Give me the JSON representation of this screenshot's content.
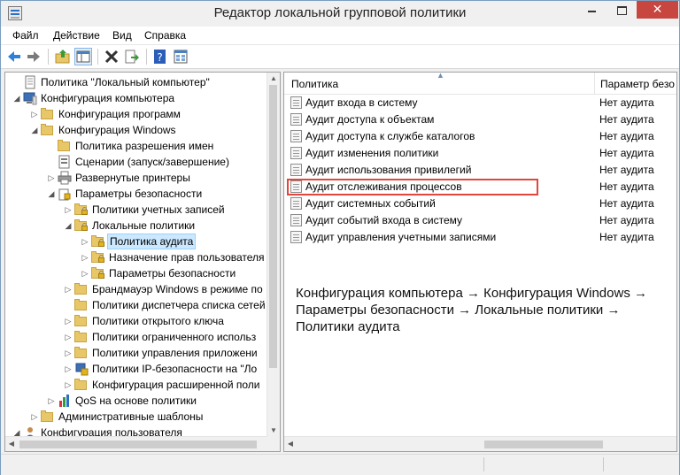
{
  "window": {
    "title": "Редактор локальной групповой политики",
    "controls": {
      "minimize": "minimize-icon",
      "maximize": "maximize-icon",
      "close": "✕"
    }
  },
  "menu": [
    {
      "label": "Файл"
    },
    {
      "label": "Действие"
    },
    {
      "label": "Вид"
    },
    {
      "label": "Справка"
    }
  ],
  "toolbar": {
    "icons": [
      "back-arrow-icon",
      "forward-arrow-icon",
      "up-folder-icon",
      "show-hide-tree-icon",
      "delete-icon",
      "export-list-icon",
      "help-icon",
      "properties-icon"
    ]
  },
  "tree": [
    {
      "label": "Политика \"Локальный компьютер\"",
      "icon": "computer-policy-icon",
      "expander": ""
    },
    {
      "label": "Конфигурация компьютера",
      "icon": "computer-icon",
      "expander": "◢"
    },
    {
      "label": "Конфигурация программ",
      "icon": "folder-icon",
      "expander": "▷"
    },
    {
      "label": "Конфигурация Windows",
      "icon": "folder-icon",
      "expander": "◢"
    },
    {
      "label": "Политика разрешения имен",
      "icon": "folder-icon",
      "expander": ""
    },
    {
      "label": "Сценарии (запуск/завершение)",
      "icon": "script-icon",
      "expander": ""
    },
    {
      "label": "Развернутые принтеры",
      "icon": "printer-icon",
      "expander": "▷"
    },
    {
      "label": "Параметры безопасности",
      "icon": "security-settings-icon",
      "expander": "◢"
    },
    {
      "label": "Политики учетных записей",
      "icon": "locked-folder-icon",
      "expander": "▷"
    },
    {
      "label": "Локальные политики",
      "icon": "locked-folder-icon",
      "expander": "◢"
    },
    {
      "label": "Политика аудита",
      "icon": "locked-folder-icon",
      "expander": "▷",
      "selected": true
    },
    {
      "label": "Назначение прав пользователя",
      "icon": "locked-folder-icon",
      "expander": "▷"
    },
    {
      "label": "Параметры безопасности",
      "icon": "locked-folder-icon",
      "expander": "▷"
    },
    {
      "label": "Брандмауэр Windows в режиме по",
      "icon": "folder-icon",
      "expander": "▷"
    },
    {
      "label": "Политики диспетчера списка сетей",
      "icon": "folder-icon",
      "expander": ""
    },
    {
      "label": "Политики открытого ключа",
      "icon": "folder-icon",
      "expander": "▷"
    },
    {
      "label": "Политики ограниченного использ",
      "icon": "folder-icon",
      "expander": "▷"
    },
    {
      "label": "Политики управления приложени",
      "icon": "folder-icon",
      "expander": "▷"
    },
    {
      "label": "Политики IP-безопасности на \"Ло",
      "icon": "ip-security-icon",
      "expander": "▷"
    },
    {
      "label": "Конфигурация расширенной поли",
      "icon": "folder-icon",
      "expander": "▷"
    },
    {
      "label": "QoS на основе политики",
      "icon": "qos-chart-icon",
      "expander": "▷"
    },
    {
      "label": "Административные шаблоны",
      "icon": "folder-icon",
      "expander": "▷"
    },
    {
      "label": "Конфигурация пользователя",
      "icon": "user-icon",
      "expander": "◢"
    }
  ],
  "list": {
    "columns": {
      "policy": "Политика",
      "setting": "Параметр безо"
    },
    "rows": [
      {
        "name": "Аудит входа в систему",
        "value": "Нет аудита"
      },
      {
        "name": "Аудит доступа к объектам",
        "value": "Нет аудита"
      },
      {
        "name": "Аудит доступа к службе каталогов",
        "value": "Нет аудита"
      },
      {
        "name": "Аудит изменения политики",
        "value": "Нет аудита"
      },
      {
        "name": "Аудит использования привилегий",
        "value": "Нет аудита"
      },
      {
        "name": "Аудит отслеживания процессов",
        "value": "Нет аудита",
        "highlighted": true
      },
      {
        "name": "Аудит системных событий",
        "value": "Нет аудита"
      },
      {
        "name": "Аудит событий входа в систему",
        "value": "Нет аудита"
      },
      {
        "name": "Аудит управления учетными записями",
        "value": "Нет аудита"
      }
    ]
  },
  "annotation": "Конфигурация компьютера → Конфигурация Windows → Параметры безопасности → Локальные политики → Политики аудита",
  "colors": {
    "highlight_border": "#e2463c",
    "selection": "#cce8ff",
    "close_button": "#c7463f"
  }
}
